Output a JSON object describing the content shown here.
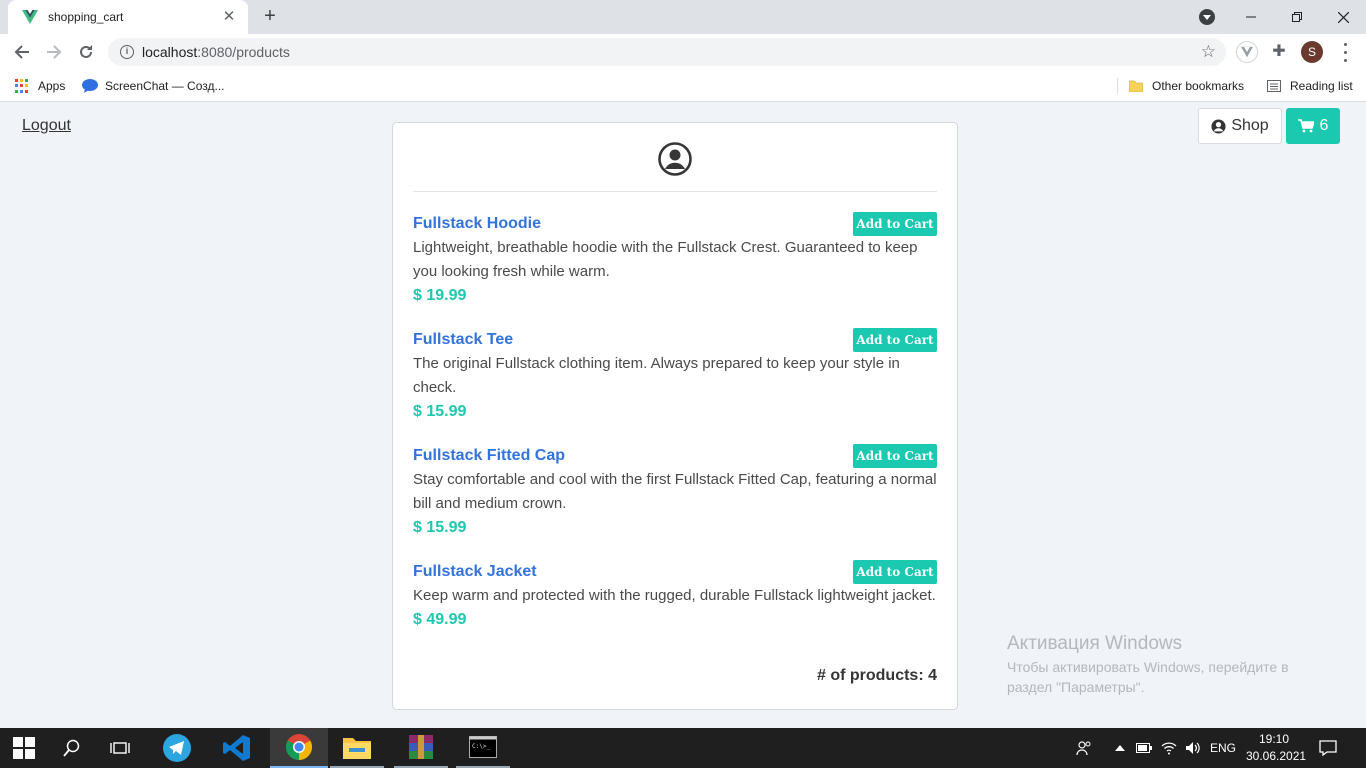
{
  "browser": {
    "tab_title": "shopping_cart",
    "tab_close": "✕",
    "new_tab": "+",
    "url_host": "localhost",
    "url_path": ":8080/products",
    "profile_initial": "S",
    "bookmarks": {
      "apps": "Apps",
      "screenchat": "ScreenChat — Созд...",
      "other": "Other bookmarks",
      "reading_list": "Reading list"
    }
  },
  "header": {
    "logout": "Logout",
    "shop": "Shop",
    "cart_count": "6"
  },
  "products": [
    {
      "name": "Fullstack Hoodie",
      "desc": "Lightweight, breathable hoodie with the Fullstack Crest. Guaranteed to keep you looking fresh while warm.",
      "price": "$ 19.99",
      "button": "Add to Cart"
    },
    {
      "name": "Fullstack Tee",
      "desc": "The original Fullstack clothing item. Always prepared to keep your style in check.",
      "price": "$ 15.99",
      "button": "Add to Cart"
    },
    {
      "name": "Fullstack Fitted Cap",
      "desc": "Stay comfortable and cool with the first Fullstack Fitted Cap, featuring a normal bill and medium crown.",
      "price": "$ 15.99",
      "button": "Add to Cart"
    },
    {
      "name": "Fullstack Jacket",
      "desc": "Keep warm and protected with the rugged, durable Fullstack lightweight jacket.",
      "price": "$ 49.99",
      "button": "Add to Cart"
    }
  ],
  "product_count": "# of products: 4",
  "activation": {
    "title": "Активация Windows",
    "text": "Чтобы активировать Windows, перейдите в раздел \"Параметры\"."
  },
  "taskbar": {
    "lang": "ENG",
    "time": "19:10",
    "date": "30.06.2021"
  },
  "colors": {
    "accent": "#1ac9b0",
    "link": "#3273dc",
    "page_bg": "#f0f3f7"
  }
}
